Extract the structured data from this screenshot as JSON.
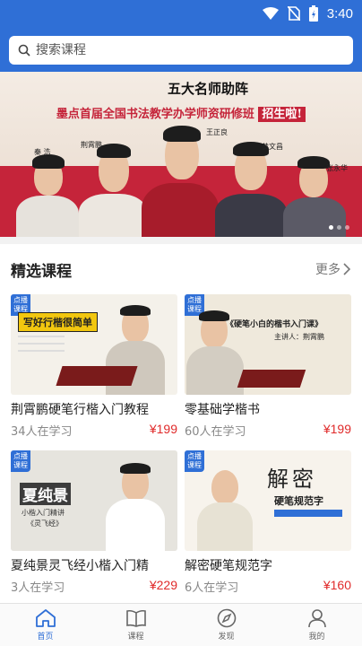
{
  "status_bar": {
    "time": "3:40"
  },
  "search": {
    "placeholder": "搜索课程"
  },
  "banner": {
    "subtitle": "五大名师助阵",
    "title_main": "墨点首届全国书法教学办学师资研修班",
    "title_highlight": "招生啦!",
    "teachers": [
      "秦 浩",
      "荆霄鹏",
      "王正良",
      "黄文昌",
      "张永华"
    ]
  },
  "section": {
    "title": "精选课程",
    "more": "更多"
  },
  "courses": [
    {
      "badge": "点播课程",
      "thumb_text": "写好行楷很简单",
      "title": "荆霄鹏硬笔行楷入门教程",
      "students": "34人在学习",
      "price": "¥199"
    },
    {
      "badge": "点播课程",
      "thumb_text": "《硬笔小白的楷书入门课》",
      "thumb_sub": "主讲人：荆霄鹏",
      "title": "零基础学楷书",
      "students": "60人在学习",
      "price": "¥199"
    },
    {
      "badge": "点播课程",
      "thumb_text": "夏纯景",
      "thumb_sub": "小楷入门精讲",
      "thumb_sub2": "《灵飞经》",
      "title": "夏纯景灵飞经小楷入门精",
      "students": "3人在学习",
      "price": "¥229"
    },
    {
      "badge": "点播课程",
      "thumb_text": "解密",
      "thumb_sub": "硬笔规范字",
      "title": "解密硬笔规范字",
      "students": "6人在学习",
      "price": "¥160"
    }
  ],
  "tabbar": [
    {
      "label": "首页",
      "icon": "home-icon",
      "active": true
    },
    {
      "label": "课程",
      "icon": "book-icon",
      "active": false
    },
    {
      "label": "发现",
      "icon": "compass-icon",
      "active": false
    },
    {
      "label": "我的",
      "icon": "user-icon",
      "active": false
    }
  ],
  "colors": {
    "primary": "#2f6fd6",
    "banner_red": "#c5243a",
    "price_red": "#e02a2a"
  }
}
